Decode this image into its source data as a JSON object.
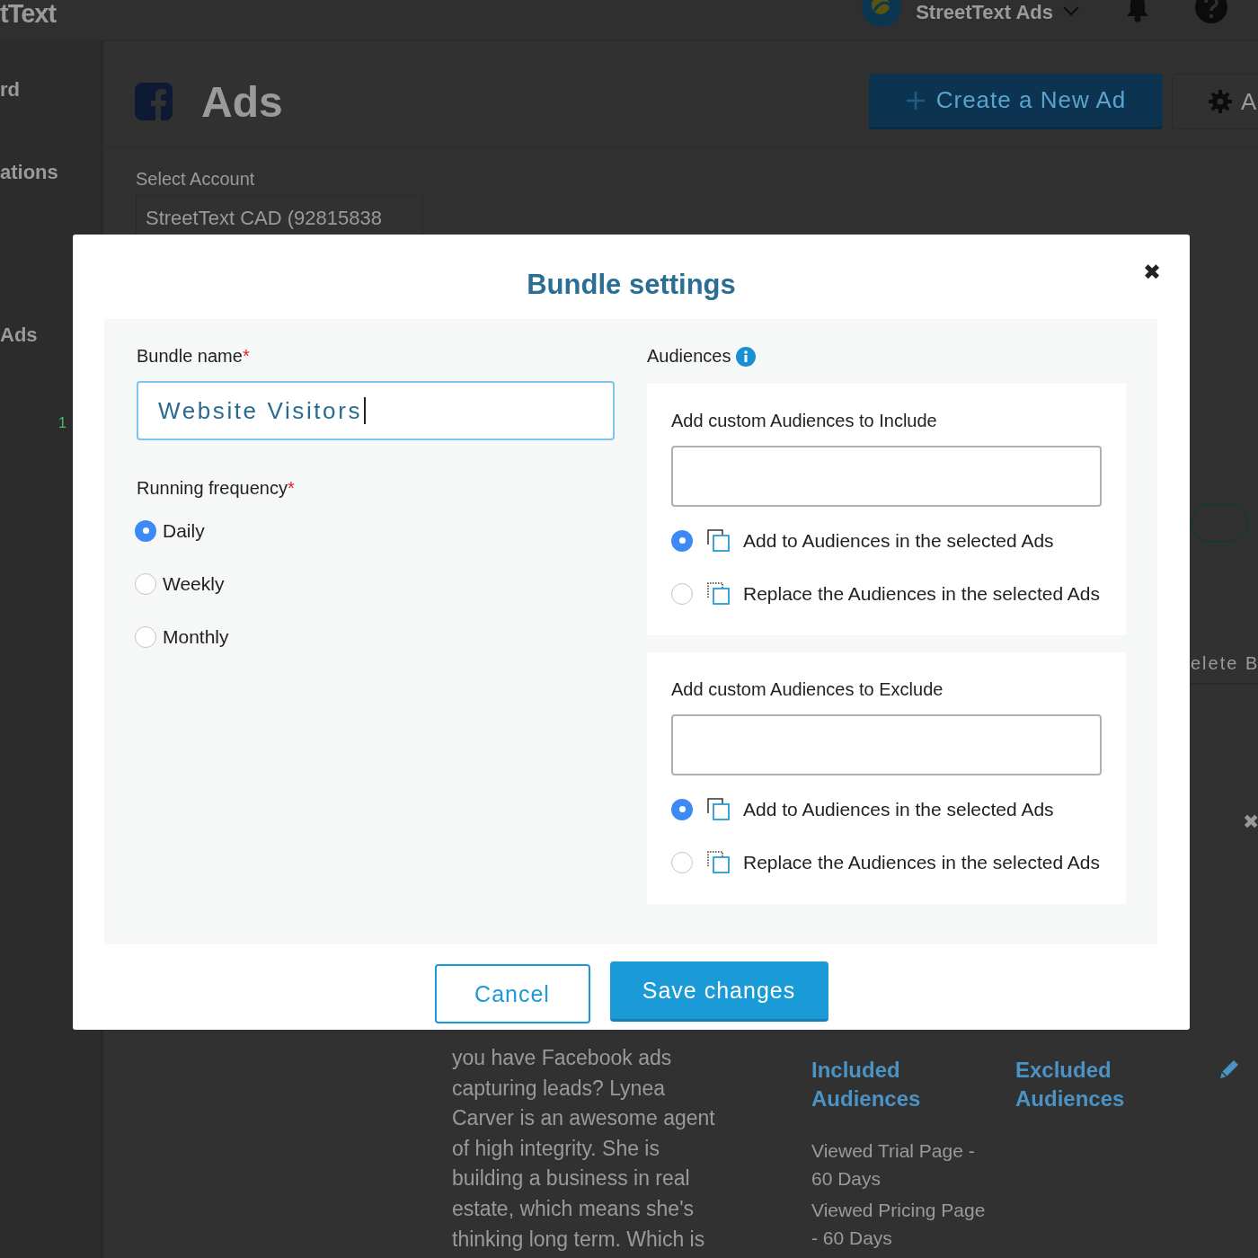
{
  "top_bar": {
    "logo": "tText",
    "account": "StreetText Ads"
  },
  "sidebar": {
    "items": [
      {
        "label": "rd"
      },
      {
        "label": "ations"
      },
      {
        "label": "Ads"
      }
    ],
    "count": "1"
  },
  "header": {
    "title": "Ads",
    "buttons": [
      {
        "label": "Create a New Ad",
        "kind": "primary"
      },
      {
        "label": "A",
        "kind": "settings"
      }
    ]
  },
  "account": {
    "label": "Select Account",
    "value": "StreetText CAD (92815838"
  },
  "side_controls": {
    "button": "elete B",
    "close": "✖"
  },
  "ad": {
    "text": "you have Facebook ads capturing leads? Lynea Carver is an awesome agent of high integrity. She is building a business in real estate, which means she's thinking long term. Which is",
    "included": {
      "title": "Included Audiences",
      "items": [
        "Viewed Trial Page - 60 Days",
        "Viewed Pricing Page - 60 Days"
      ]
    },
    "excluded": {
      "title": "Excluded Audiences"
    }
  },
  "modal": {
    "title": "Bundle settings",
    "close": "✖",
    "bundle_name": {
      "label": "Bundle name",
      "required_mark": "*",
      "value": "Website Visitors"
    },
    "frequency": {
      "label": "Running frequency",
      "required_mark": "*",
      "options": [
        {
          "label": "Daily",
          "selected": true
        },
        {
          "label": "Weekly",
          "selected": false
        },
        {
          "label": "Monthly",
          "selected": false
        }
      ]
    },
    "audiences": {
      "label": "Audiences",
      "sections": [
        {
          "title": "Add custom Audiences to Include",
          "options": [
            {
              "label": "Add to Audiences in the selected Ads",
              "kind": "add",
              "selected": true
            },
            {
              "label": "Replace the Audiences in the selected Ads",
              "kind": "replace",
              "selected": false
            }
          ]
        },
        {
          "title": "Add custom Audiences to Exclude",
          "options": [
            {
              "label": "Add to Audiences in the selected Ads",
              "kind": "add",
              "selected": true
            },
            {
              "label": "Replace the Audiences in the selected Ads",
              "kind": "replace",
              "selected": false
            }
          ]
        }
      ]
    },
    "buttons": [
      {
        "label": "Cancel",
        "kind": "secondary"
      },
      {
        "label": "Save changes",
        "kind": "primary"
      }
    ]
  }
}
